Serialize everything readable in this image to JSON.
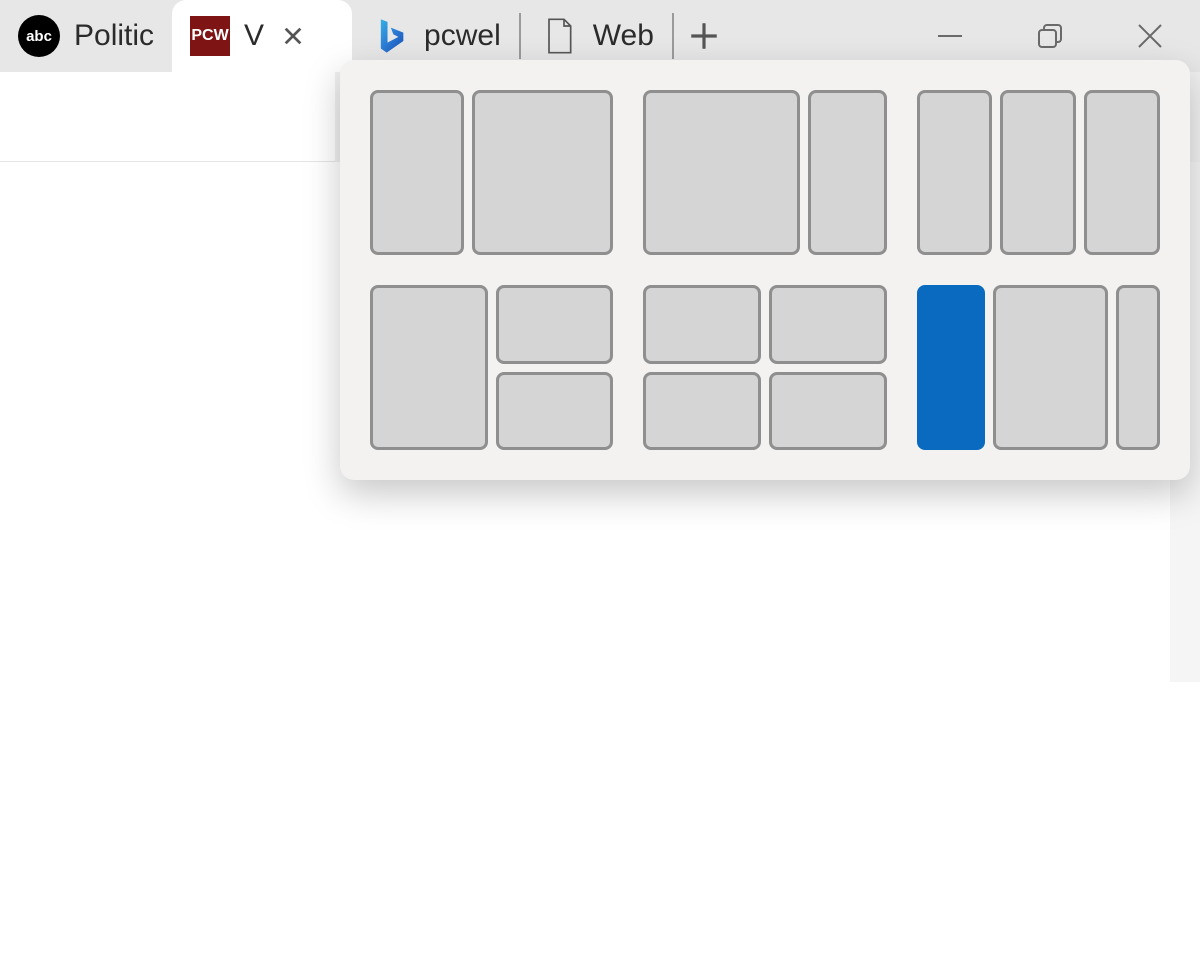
{
  "tabs": [
    {
      "favicon_name": "abc-icon",
      "favicon_text": "abc",
      "title": "Politic",
      "active": false
    },
    {
      "favicon_name": "pcw-icon",
      "favicon_text": "PCW",
      "title": "V",
      "active": true,
      "closable": true
    },
    {
      "favicon_name": "bing-icon",
      "favicon_text": "",
      "title": "pcwel",
      "active": false
    },
    {
      "favicon_name": "page-icon",
      "favicon_text": "",
      "title": "Web",
      "active": false
    }
  ],
  "snap_layouts": {
    "selected": "layout-6-zone-1",
    "options": [
      {
        "id": "layout-1",
        "zones": 2
      },
      {
        "id": "layout-2",
        "zones": 2
      },
      {
        "id": "layout-3",
        "zones": 3
      },
      {
        "id": "layout-4",
        "zones": 3
      },
      {
        "id": "layout-5",
        "zones": 4
      },
      {
        "id": "layout-6",
        "zones": 3
      }
    ]
  },
  "colors": {
    "snap_selected": "#0a6ac0"
  }
}
